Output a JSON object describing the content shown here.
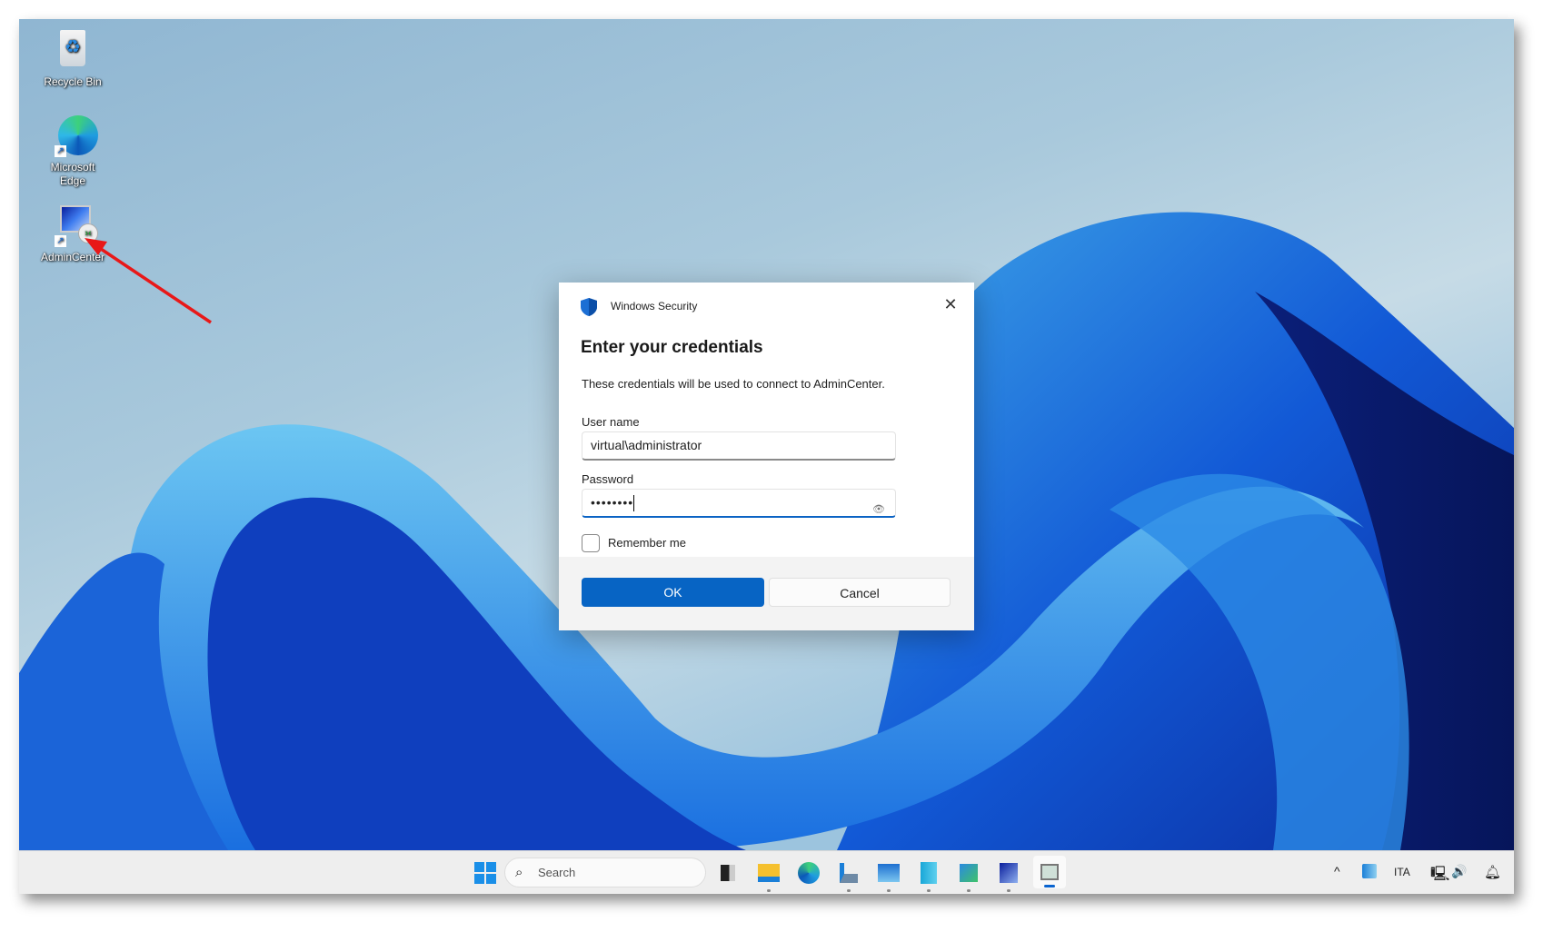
{
  "desktop": {
    "icons": [
      {
        "label": "Recycle Bin",
        "icon": "recycle-bin-icon"
      },
      {
        "label": "Microsoft Edge",
        "icon": "edge-icon"
      },
      {
        "label": "AdminCenter",
        "icon": "remote-desktop-icon"
      }
    ]
  },
  "dialog": {
    "app_title": "Windows Security",
    "heading": "Enter your credentials",
    "description": "These credentials will be used to connect to AdminCenter.",
    "username_label": "User name",
    "username_value": "virtual\\administrator",
    "password_label": "Password",
    "password_value": "••••••••",
    "remember_label": "Remember me",
    "remember_checked": false,
    "ok_label": "OK",
    "cancel_label": "Cancel",
    "accent": "#0764c4"
  },
  "taskbar": {
    "search_placeholder": "Search",
    "apps": [
      "task-view",
      "file-explorer",
      "edge",
      "server-manager",
      "resource-monitor",
      "hyper-v",
      "network",
      "remote-desktop",
      "active-window"
    ],
    "tray": {
      "language": "ITA"
    }
  }
}
